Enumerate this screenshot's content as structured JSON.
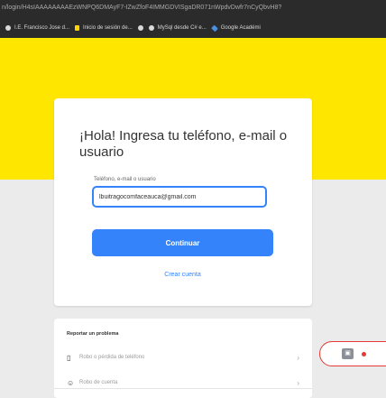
{
  "browser": {
    "url": "n/login/H4sIAAAAAAAAEzWNPQ6DMAyF7-IZwZfoF4IMMGDVISgaDR071nWpdvDwfr7nCyQbvH8?",
    "bookmarks": [
      {
        "label": "I.E. Francisco Jose d...",
        "icon": "globe-icon"
      },
      {
        "label": "Inicio de sesión de...",
        "icon": "mercadolibre-icon"
      },
      {
        "label": "",
        "icon": "globe-icon"
      },
      {
        "label": "MySql desde C# e...",
        "icon": "globe-icon"
      },
      {
        "label": "Google Académi",
        "icon": "scholar-icon"
      }
    ]
  },
  "login": {
    "heading": "¡Hola! Ingresa tu teléfono, e-mail o usuario",
    "field_label": "Teléfono, e-mail o usuario",
    "email_value": "lbuitragocomfaceauca@gmail.com",
    "continue_label": "Continuar",
    "create_account_label": "Crear cuenta"
  },
  "problems": {
    "title": "Reportar un problema",
    "items": [
      {
        "label": "Robo o pérdida de teléfono",
        "icon": "phone-icon"
      },
      {
        "label": "Robo de cuenta",
        "icon": "person-icon"
      }
    ]
  },
  "colors": {
    "brand_yellow": "#ffe600",
    "primary_blue": "#3483fa",
    "help_red": "#e53935"
  }
}
